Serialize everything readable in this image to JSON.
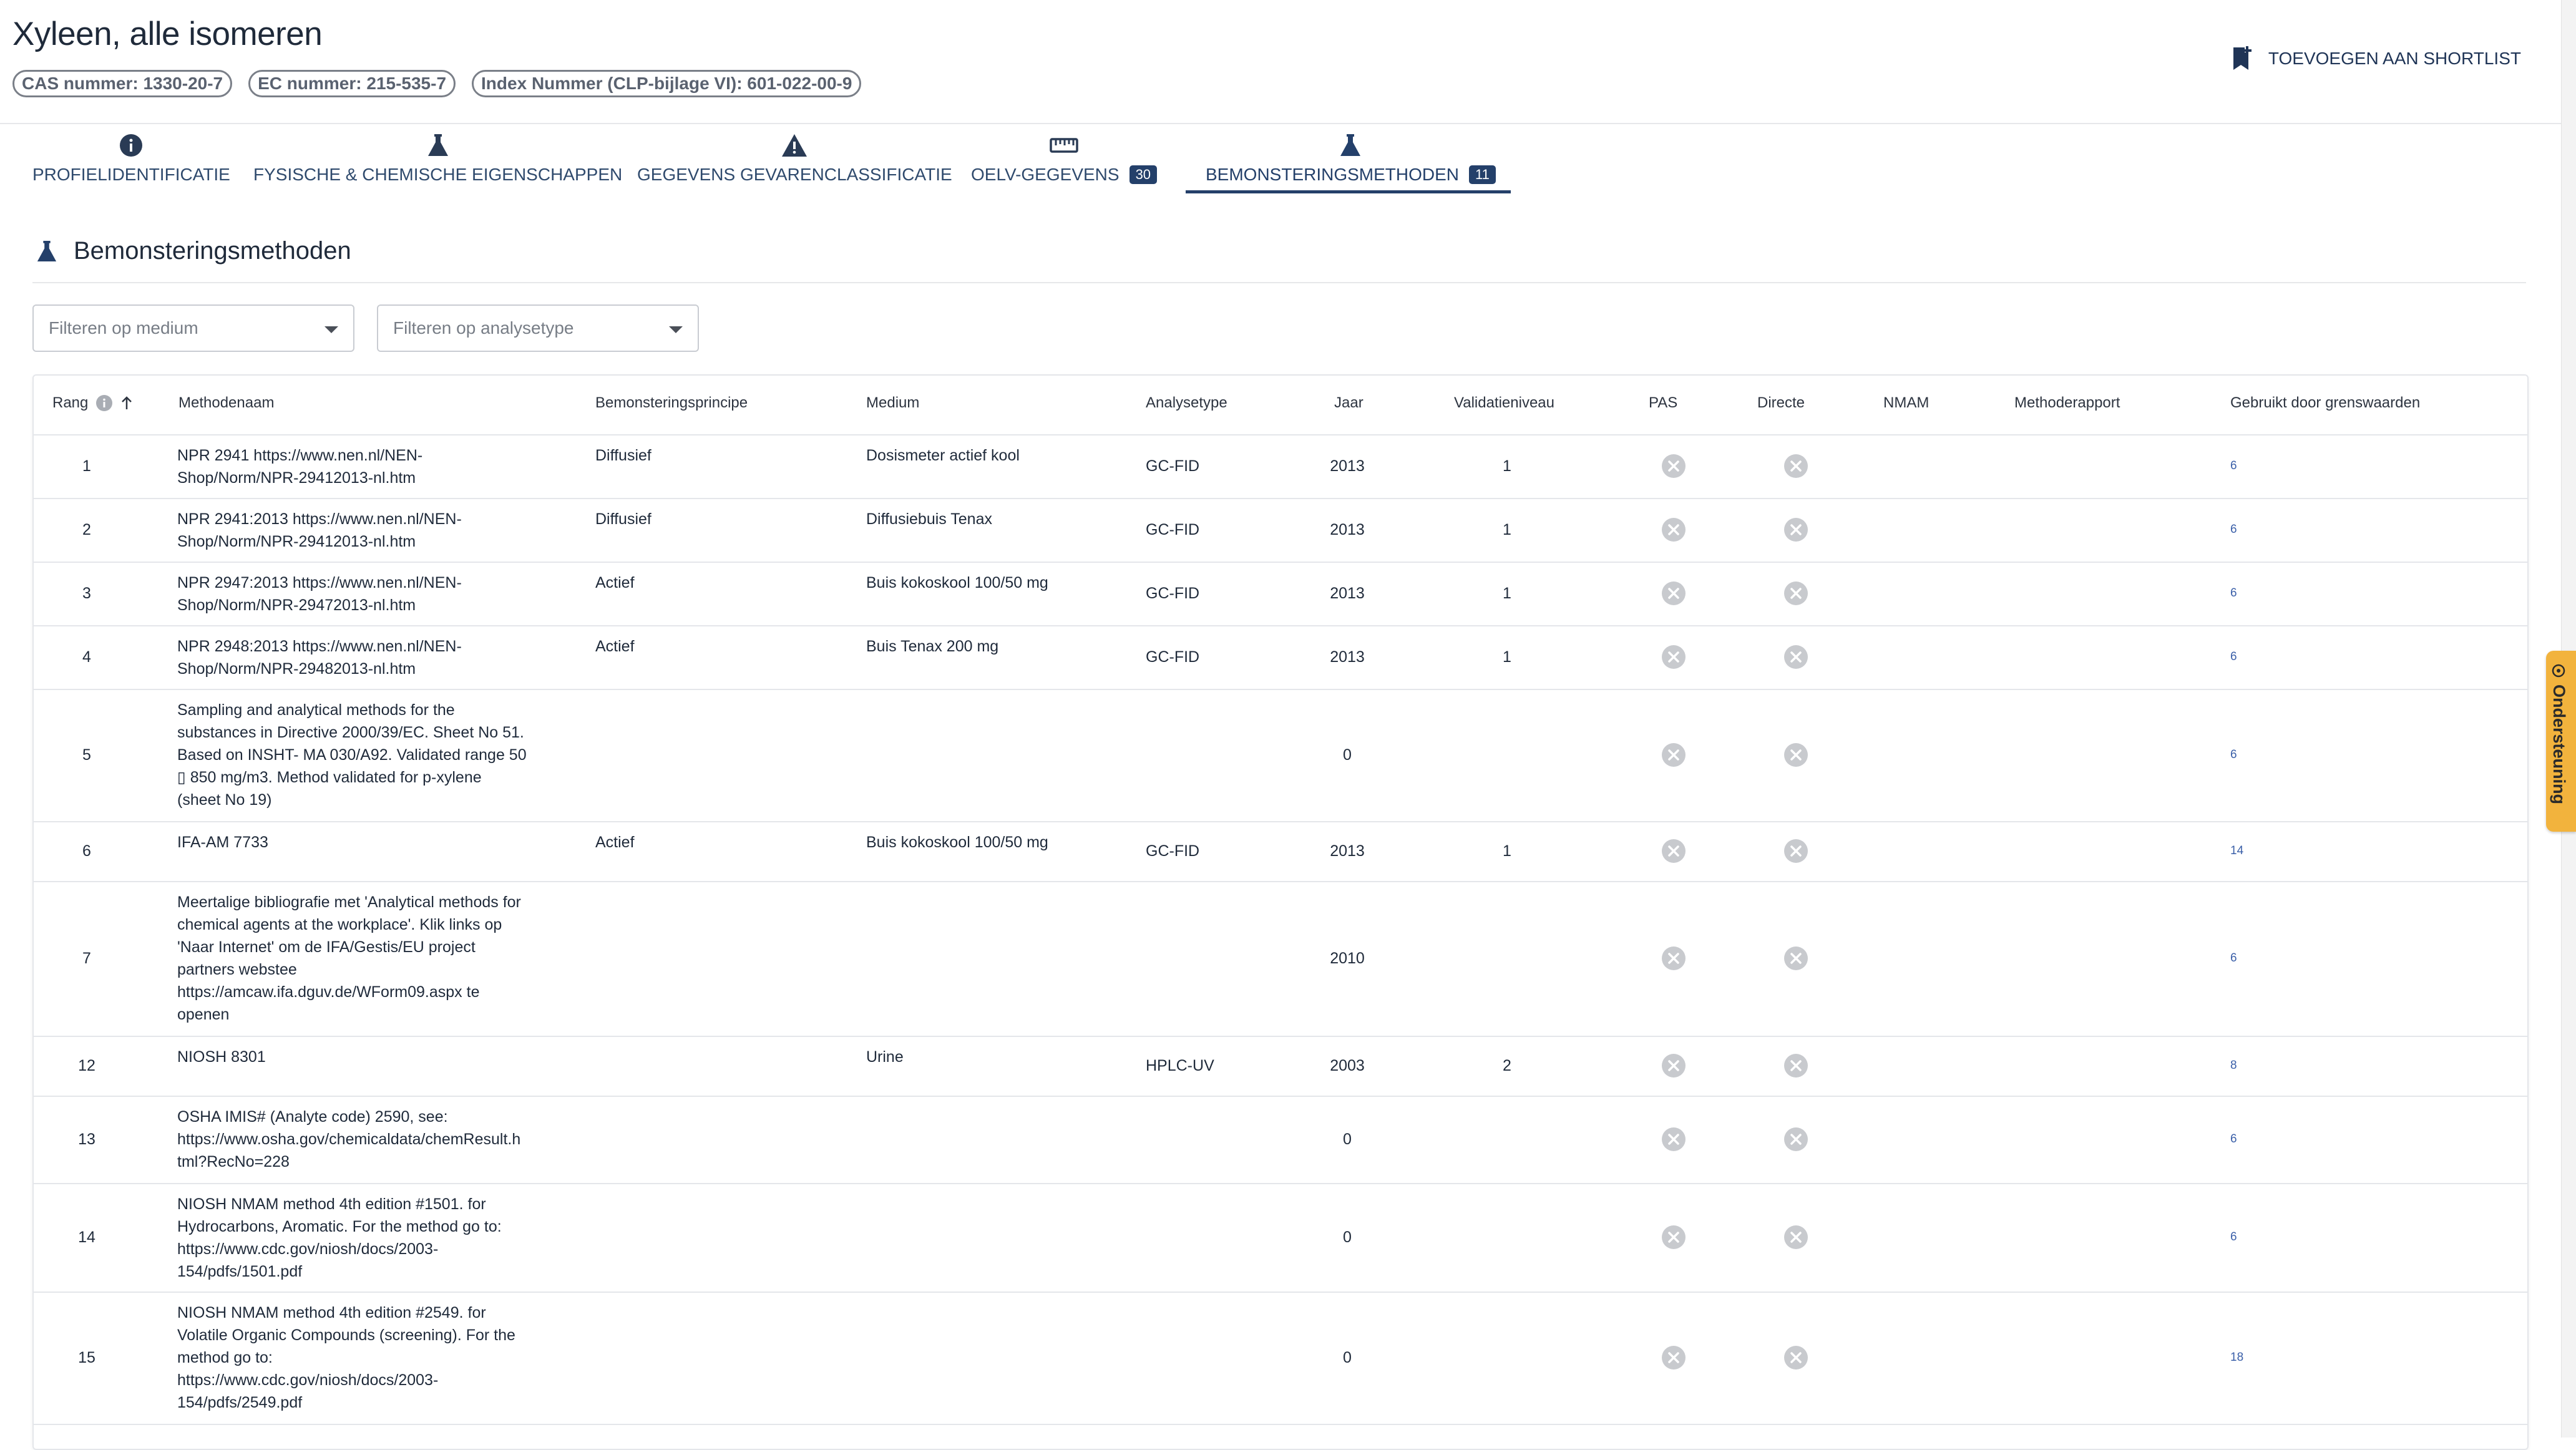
{
  "header": {
    "title": "Xyleen, alle isomeren",
    "chips": [
      "CAS nummer: 1330-20-7",
      "EC nummer: 215-535-7",
      "Index Nummer (CLP-bijlage VI): 601-022-00-9"
    ],
    "shortlist_label": "TOEVOEGEN AAN SHORTLIST"
  },
  "tabs": [
    {
      "label": "PROFIELIDENTIFICATIE",
      "icon": "info-icon"
    },
    {
      "label": "FYSISCHE & CHEMISCHE EIGENSCHAPPEN",
      "icon": "flask-icon"
    },
    {
      "label": "GEGEVENS GEVARENCLASSIFICATIE",
      "icon": "warning-icon"
    },
    {
      "label": "OELV-GEGEVENS",
      "icon": "ruler-icon",
      "badge": "30"
    },
    {
      "label": "BEMONSTERINGSMETHODEN",
      "icon": "flask-icon",
      "badge": "11",
      "active": true
    }
  ],
  "section": {
    "title": "Bemonsteringsmethoden"
  },
  "filters": {
    "medium_placeholder": "Filteren op medium",
    "analysis_placeholder": "Filteren op analysetype"
  },
  "table": {
    "columns": {
      "rang": "Rang",
      "methodenaam": "Methodenaam",
      "principe": "Bemonsteringsprincipe",
      "medium": "Medium",
      "analysetype": "Analysetype",
      "jaar": "Jaar",
      "validatie": "Validatieniveau",
      "pas": "PAS",
      "directe": "Directe",
      "nmam": "NMAM",
      "rapport": "Methoderapport",
      "gebruikt": "Gebruikt door grenswaarden"
    },
    "rows": [
      {
        "rang": "1",
        "name": [
          "NPR 2941 https://www.nen.nl/NEN-",
          "Shop/Norm/NPR-29412013-nl.htm"
        ],
        "principe": "Diffusief",
        "medium": "Dosismeter actief kool",
        "analysetype": "GC-FID",
        "jaar": "2013",
        "validatie": "1",
        "gebruikt": "6"
      },
      {
        "rang": "2",
        "name": [
          "NPR 2941:2013 https://www.nen.nl/NEN-",
          "Shop/Norm/NPR-29412013-nl.htm"
        ],
        "principe": "Diffusief",
        "medium": "Diffusiebuis Tenax",
        "analysetype": "GC-FID",
        "jaar": "2013",
        "validatie": "1",
        "gebruikt": "6"
      },
      {
        "rang": "3",
        "name": [
          "NPR 2947:2013 https://www.nen.nl/NEN-",
          "Shop/Norm/NPR-29472013-nl.htm"
        ],
        "principe": "Actief",
        "medium": "Buis kokoskool 100/50 mg",
        "analysetype": "GC-FID",
        "jaar": "2013",
        "validatie": "1",
        "gebruikt": "6"
      },
      {
        "rang": "4",
        "name": [
          "NPR 2948:2013 https://www.nen.nl/NEN-",
          "Shop/Norm/NPR-29482013-nl.htm"
        ],
        "principe": "Actief",
        "medium": "Buis Tenax 200 mg",
        "analysetype": "GC-FID",
        "jaar": "2013",
        "validatie": "1",
        "gebruikt": "6"
      },
      {
        "rang": "5",
        "name": [
          "Sampling and analytical methods for the",
          "substances in Directive 2000/39/EC. Sheet No 51.",
          "Based on INSHT- MA 030/A92. Validated range 50",
          "▯ 850 mg/m3. Method validated for p-xylene",
          "(sheet No 19)"
        ],
        "principe": "",
        "medium": "",
        "analysetype": "",
        "jaar": "0",
        "validatie": "",
        "gebruikt": "6"
      },
      {
        "rang": "6",
        "name": [
          "IFA-AM 7733"
        ],
        "principe": "Actief",
        "medium": "Buis kokoskool 100/50 mg",
        "analysetype": "GC-FID",
        "jaar": "2013",
        "validatie": "1",
        "gebruikt": "14"
      },
      {
        "rang": "7",
        "name": [
          "Meertalige bibliografie met 'Analytical methods for",
          "chemical agents at the workplace'. Klik links op",
          "'Naar Internet' om de IFA/Gestis/EU project",
          "partners webstee",
          "https://amcaw.ifa.dguv.de/WForm09.aspx te",
          "openen"
        ],
        "principe": "",
        "medium": "",
        "analysetype": "",
        "jaar": "2010",
        "validatie": "",
        "gebruikt": "6"
      },
      {
        "rang": "12",
        "name": [
          "NIOSH 8301"
        ],
        "principe": "",
        "medium": "Urine",
        "analysetype": "HPLC-UV",
        "jaar": "2003",
        "validatie": "2",
        "gebruikt": "8"
      },
      {
        "rang": "13",
        "name": [
          "OSHA IMIS# (Analyte code) 2590, see:",
          "https://www.osha.gov/chemicaldata/chemResult.h",
          "tml?RecNo=228"
        ],
        "principe": "",
        "medium": "",
        "analysetype": "",
        "jaar": "0",
        "validatie": "",
        "gebruikt": "6"
      },
      {
        "rang": "14",
        "name": [
          "NIOSH NMAM method 4th edition #1501. for",
          "Hydrocarbons, Aromatic. For the method go to:",
          "https://www.cdc.gov/niosh/docs/2003-",
          "154/pdfs/1501.pdf"
        ],
        "principe": "",
        "medium": "",
        "analysetype": "",
        "jaar": "0",
        "validatie": "",
        "gebruikt": "6"
      },
      {
        "rang": "15",
        "name": [
          "NIOSH NMAM method 4th edition #2549. for",
          "Volatile Organic Compounds (screening). For the",
          "method go to:",
          "https://www.cdc.gov/niosh/docs/2003-",
          "154/pdfs/2549.pdf"
        ],
        "principe": "",
        "medium": "",
        "analysetype": "",
        "jaar": "0",
        "validatie": "",
        "gebruikt": "18"
      }
    ]
  },
  "support_tab": {
    "label": "Ondersteuning"
  },
  "colors": {
    "accent": "#24406a",
    "link": "#3a5fa8",
    "support": "#f2b33d"
  }
}
